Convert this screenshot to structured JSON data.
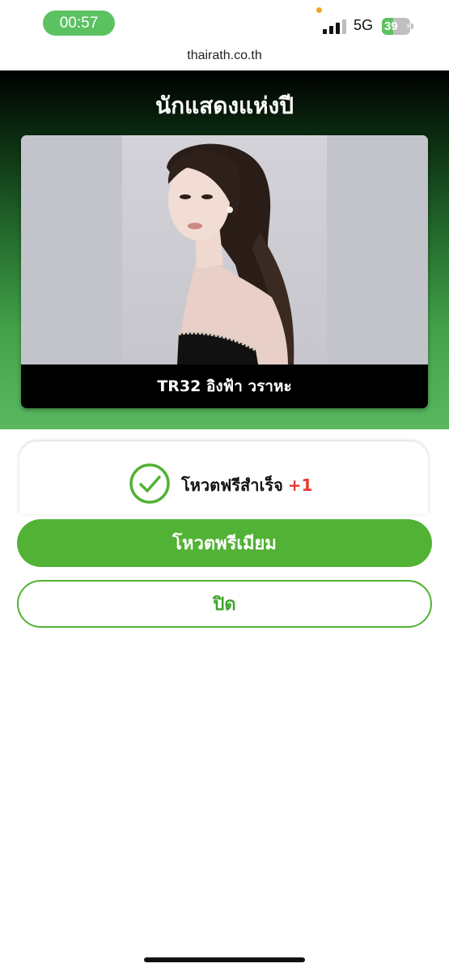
{
  "status_bar": {
    "time": "00:57",
    "network": "5G",
    "battery_percent": "39",
    "battery_level": 0.39,
    "battery_charging_glyph": "⚡"
  },
  "browser": {
    "url": "thairath.co.th"
  },
  "hero": {
    "title": "นักแสดงแห่งปี"
  },
  "candidate": {
    "name": "TR32 อิงฟ้า วราหะ"
  },
  "result": {
    "message": "โหวตฟรีสำเร็จ",
    "increment": "+1",
    "icon": "check-circle-icon"
  },
  "actions": {
    "premium_label": "โหวตพรีเมียม",
    "close_label": "ปิด"
  },
  "colors": {
    "accent_green": "#52b235",
    "increment_red": "#e53935",
    "time_pill_green": "#5cc261"
  }
}
